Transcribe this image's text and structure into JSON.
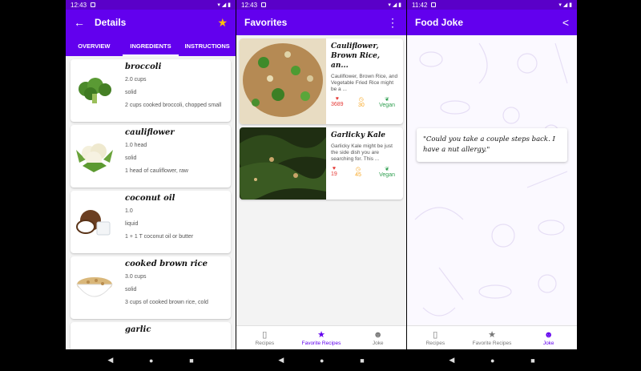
{
  "screens": [
    {
      "status": {
        "time": "12:43"
      },
      "appbar": {
        "title": "Details",
        "back_icon": "arrow-left-icon",
        "action_icon": "star-icon",
        "action_color": "#ffc107"
      },
      "tabs": [
        {
          "label": "OVERVIEW",
          "active": false
        },
        {
          "label": "INGREDIENTS",
          "active": true
        },
        {
          "label": "INSTRUCTIONS",
          "active": false
        }
      ],
      "ingredients": [
        {
          "name": "broccoli",
          "amount": "2.0  cups",
          "consistency": "solid",
          "original": "2 cups cooked broccoli, chopped small"
        },
        {
          "name": "cauliflower",
          "amount": "1.0  head",
          "consistency": "solid",
          "original": "1 head of cauliflower, raw"
        },
        {
          "name": "coconut oil",
          "amount": "1.0",
          "consistency": "liquid",
          "original": "1 + 1 T coconut oil or butter"
        },
        {
          "name": "cooked brown rice",
          "amount": "3.0  cups",
          "consistency": "solid",
          "original": "3 cups of cooked brown rice, cold"
        },
        {
          "name": "garlic",
          "amount": "",
          "consistency": "",
          "original": ""
        }
      ]
    },
    {
      "status": {
        "time": "12:43"
      },
      "appbar": {
        "title": "Favorites",
        "action_icon": "more-vert-icon"
      },
      "favorites": [
        {
          "title": "Cauliflower, Brown Rice, an...",
          "description": "Cauliflower, Brown Rice, and Vegetable Fried Rice might be a ...",
          "likes": "3689",
          "minutes": "30",
          "vegan": "Vegan"
        },
        {
          "title": "Garlicky Kale",
          "description": "Garlicky Kale might be just the side dish you are searching for. This ...",
          "likes": "19",
          "minutes": "45",
          "vegan": "Vegan"
        }
      ]
    },
    {
      "status": {
        "time": "11:42"
      },
      "appbar": {
        "title": "Food Joke",
        "action_icon": "share-icon"
      },
      "joke": "\"Could you take a couple steps back. I have a nut allergy.\""
    }
  ],
  "bottom_nav": [
    {
      "label": "Recipes",
      "icon": "book-icon"
    },
    {
      "label": "Favorite Recipes",
      "icon": "star-icon"
    },
    {
      "label": "Joke",
      "icon": "smiley-icon"
    }
  ],
  "colors": {
    "primary": "#6200ee",
    "status": "#5a00c8",
    "heart": "#e53935",
    "clock": "#f9a825",
    "leaf": "#2e9e4f"
  }
}
